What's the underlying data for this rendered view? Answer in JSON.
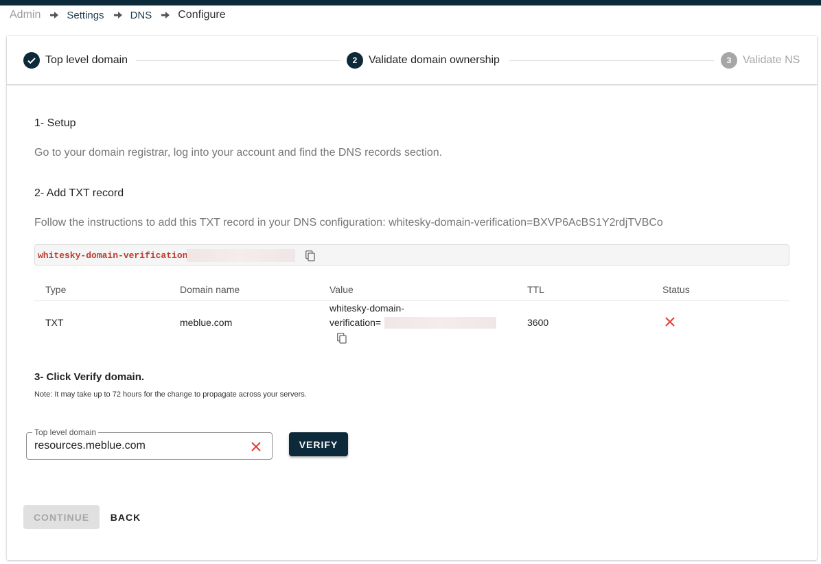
{
  "breadcrumb": {
    "items": [
      "Admin",
      "Settings",
      "DNS",
      "Configure"
    ]
  },
  "stepper": {
    "steps": [
      {
        "number": "1",
        "label": "Top level domain",
        "state": "done"
      },
      {
        "number": "2",
        "label": "Validate domain ownership",
        "state": "active"
      },
      {
        "number": "3",
        "label": "Validate NS",
        "state": "inactive"
      }
    ]
  },
  "section1": {
    "title": "1- Setup",
    "text": "Go to your domain registrar, log into your account and find the DNS records section."
  },
  "section2": {
    "title": "2- Add TXT record",
    "text": "Follow the instructions to add this TXT record in your DNS configuration: whitesky-domain-verification=BXVP6AcBS1Y2rdjTVBCo",
    "code": "whitesky-domain-verification="
  },
  "table": {
    "headers": [
      "Type",
      "Domain name",
      "Value",
      "TTL",
      "Status"
    ],
    "row": {
      "type": "TXT",
      "domain": "meblue.com",
      "value_line1": "whitesky-domain-",
      "value_line2": "verification=",
      "ttl": "3600",
      "status": "failed"
    }
  },
  "section3": {
    "title": "3- Click Verify domain.",
    "note": "Note: It may take up to 72 hours for the change to propagate across your servers."
  },
  "domain_field": {
    "label": "Top level domain",
    "value": "resources.meblue.com"
  },
  "buttons": {
    "verify": "VERIFY",
    "continue": "CONTINUE",
    "back": "BACK"
  },
  "colors": {
    "primary": "#0d2a3a",
    "error": "#e53935",
    "disabled": "#a6a6a6"
  }
}
